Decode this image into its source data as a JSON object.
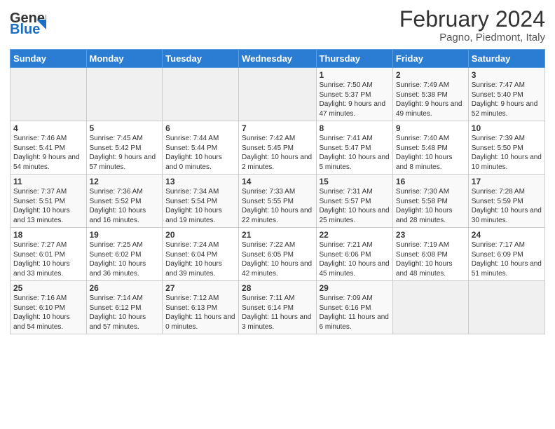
{
  "header": {
    "logo_line1": "General",
    "logo_line2": "Blue",
    "title": "February 2024",
    "subtitle": "Pagno, Piedmont, Italy"
  },
  "weekdays": [
    "Sunday",
    "Monday",
    "Tuesday",
    "Wednesday",
    "Thursday",
    "Friday",
    "Saturday"
  ],
  "weeks": [
    [
      {
        "day": "",
        "info": ""
      },
      {
        "day": "",
        "info": ""
      },
      {
        "day": "",
        "info": ""
      },
      {
        "day": "",
        "info": ""
      },
      {
        "day": "1",
        "info": "Sunrise: 7:50 AM\nSunset: 5:37 PM\nDaylight: 9 hours\nand 47 minutes."
      },
      {
        "day": "2",
        "info": "Sunrise: 7:49 AM\nSunset: 5:38 PM\nDaylight: 9 hours\nand 49 minutes."
      },
      {
        "day": "3",
        "info": "Sunrise: 7:47 AM\nSunset: 5:40 PM\nDaylight: 9 hours\nand 52 minutes."
      }
    ],
    [
      {
        "day": "4",
        "info": "Sunrise: 7:46 AM\nSunset: 5:41 PM\nDaylight: 9 hours\nand 54 minutes."
      },
      {
        "day": "5",
        "info": "Sunrise: 7:45 AM\nSunset: 5:42 PM\nDaylight: 9 hours\nand 57 minutes."
      },
      {
        "day": "6",
        "info": "Sunrise: 7:44 AM\nSunset: 5:44 PM\nDaylight: 10 hours\nand 0 minutes."
      },
      {
        "day": "7",
        "info": "Sunrise: 7:42 AM\nSunset: 5:45 PM\nDaylight: 10 hours\nand 2 minutes."
      },
      {
        "day": "8",
        "info": "Sunrise: 7:41 AM\nSunset: 5:47 PM\nDaylight: 10 hours\nand 5 minutes."
      },
      {
        "day": "9",
        "info": "Sunrise: 7:40 AM\nSunset: 5:48 PM\nDaylight: 10 hours\nand 8 minutes."
      },
      {
        "day": "10",
        "info": "Sunrise: 7:39 AM\nSunset: 5:50 PM\nDaylight: 10 hours\nand 10 minutes."
      }
    ],
    [
      {
        "day": "11",
        "info": "Sunrise: 7:37 AM\nSunset: 5:51 PM\nDaylight: 10 hours\nand 13 minutes."
      },
      {
        "day": "12",
        "info": "Sunrise: 7:36 AM\nSunset: 5:52 PM\nDaylight: 10 hours\nand 16 minutes."
      },
      {
        "day": "13",
        "info": "Sunrise: 7:34 AM\nSunset: 5:54 PM\nDaylight: 10 hours\nand 19 minutes."
      },
      {
        "day": "14",
        "info": "Sunrise: 7:33 AM\nSunset: 5:55 PM\nDaylight: 10 hours\nand 22 minutes."
      },
      {
        "day": "15",
        "info": "Sunrise: 7:31 AM\nSunset: 5:57 PM\nDaylight: 10 hours\nand 25 minutes."
      },
      {
        "day": "16",
        "info": "Sunrise: 7:30 AM\nSunset: 5:58 PM\nDaylight: 10 hours\nand 28 minutes."
      },
      {
        "day": "17",
        "info": "Sunrise: 7:28 AM\nSunset: 5:59 PM\nDaylight: 10 hours\nand 30 minutes."
      }
    ],
    [
      {
        "day": "18",
        "info": "Sunrise: 7:27 AM\nSunset: 6:01 PM\nDaylight: 10 hours\nand 33 minutes."
      },
      {
        "day": "19",
        "info": "Sunrise: 7:25 AM\nSunset: 6:02 PM\nDaylight: 10 hours\nand 36 minutes."
      },
      {
        "day": "20",
        "info": "Sunrise: 7:24 AM\nSunset: 6:04 PM\nDaylight: 10 hours\nand 39 minutes."
      },
      {
        "day": "21",
        "info": "Sunrise: 7:22 AM\nSunset: 6:05 PM\nDaylight: 10 hours\nand 42 minutes."
      },
      {
        "day": "22",
        "info": "Sunrise: 7:21 AM\nSunset: 6:06 PM\nDaylight: 10 hours\nand 45 minutes."
      },
      {
        "day": "23",
        "info": "Sunrise: 7:19 AM\nSunset: 6:08 PM\nDaylight: 10 hours\nand 48 minutes."
      },
      {
        "day": "24",
        "info": "Sunrise: 7:17 AM\nSunset: 6:09 PM\nDaylight: 10 hours\nand 51 minutes."
      }
    ],
    [
      {
        "day": "25",
        "info": "Sunrise: 7:16 AM\nSunset: 6:10 PM\nDaylight: 10 hours\nand 54 minutes."
      },
      {
        "day": "26",
        "info": "Sunrise: 7:14 AM\nSunset: 6:12 PM\nDaylight: 10 hours\nand 57 minutes."
      },
      {
        "day": "27",
        "info": "Sunrise: 7:12 AM\nSunset: 6:13 PM\nDaylight: 11 hours\nand 0 minutes."
      },
      {
        "day": "28",
        "info": "Sunrise: 7:11 AM\nSunset: 6:14 PM\nDaylight: 11 hours\nand 3 minutes."
      },
      {
        "day": "29",
        "info": "Sunrise: 7:09 AM\nSunset: 6:16 PM\nDaylight: 11 hours\nand 6 minutes."
      },
      {
        "day": "",
        "info": ""
      },
      {
        "day": "",
        "info": ""
      }
    ]
  ]
}
